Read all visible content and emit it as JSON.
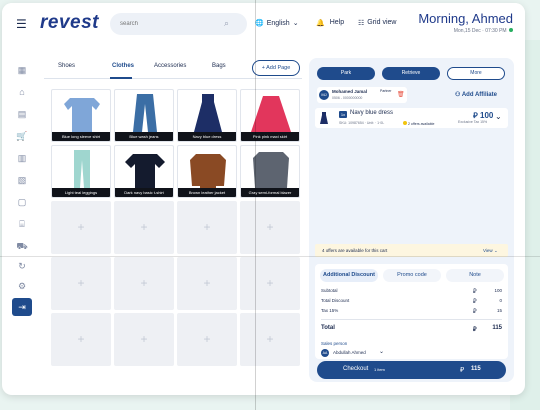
{
  "header": {
    "logo": "revest",
    "search_placeholder": "search",
    "language": "English",
    "help": "Help",
    "grid_view": "Grid view",
    "greeting": "Morning, Ahmed",
    "datetime": "Mon,15 Dec · 07:30 PM"
  },
  "sidebar": {
    "items": [
      "grid-icon",
      "home-icon",
      "calculator-icon",
      "cart-icon",
      "building-icon",
      "receipt-icon",
      "document-icon",
      "store-icon",
      "truck-icon",
      "cycle-icon",
      "settings-icon"
    ],
    "logout": "logout-icon"
  },
  "catalog": {
    "tabs": [
      "Shoes",
      "Clothes",
      "Accessories",
      "Bags"
    ],
    "active_tab": "Clothes",
    "add_page": "+ Add Page",
    "products": [
      {
        "label": "Blue long sleeve shirt",
        "color": "#7fa6d8"
      },
      {
        "label": "Blue wash jeans",
        "color": "#3b6ea5"
      },
      {
        "label": "Navy blue dress",
        "color": "#1d2e66"
      },
      {
        "label": "Pink pink maxi skirt",
        "color": "#e2365c"
      },
      {
        "label": "Light teal leggings",
        "color": "#9fd6cf"
      },
      {
        "label": "Dark navy basic t-shirt",
        "color": "#141b2e"
      },
      {
        "label": "Brown leather jacket",
        "color": "#8a4a24"
      },
      {
        "label": "Gray semi-formal blazer",
        "color": "#5d6470"
      }
    ]
  },
  "order": {
    "actions": [
      "Park",
      "Retrieve",
      "More"
    ],
    "customer": {
      "initials": "MJ",
      "name": "Mohamed Jamal",
      "phone": "0506 - 0000000000",
      "badge": "Partner"
    },
    "add_affiliate": "Add Affiliate",
    "item": {
      "qty": "1x",
      "name": "Navy blue dress",
      "meta": "SKU: 10987654 · Unit: · 1·0L",
      "offers": "2 offers available",
      "price": "100",
      "price_note": "Exclusive Tax 15%"
    },
    "offer_text": "4 offers are available for this cart",
    "offer_view": "View",
    "summary_tabs": [
      "Additional Discount",
      "Promo code",
      "Note"
    ],
    "rows": [
      {
        "label": "Subtotal",
        "value": "100"
      },
      {
        "label": "Total Discount",
        "value": "0"
      },
      {
        "label": "Tax 15%",
        "value": "15"
      }
    ],
    "total_label": "Total",
    "total_value": "115",
    "sales_label": "Sales person",
    "sales_initials": "AA",
    "sales_name": "Abdullah Ahmed",
    "checkout": "Checkout",
    "checkout_items": "1 item",
    "checkout_value": "115"
  }
}
